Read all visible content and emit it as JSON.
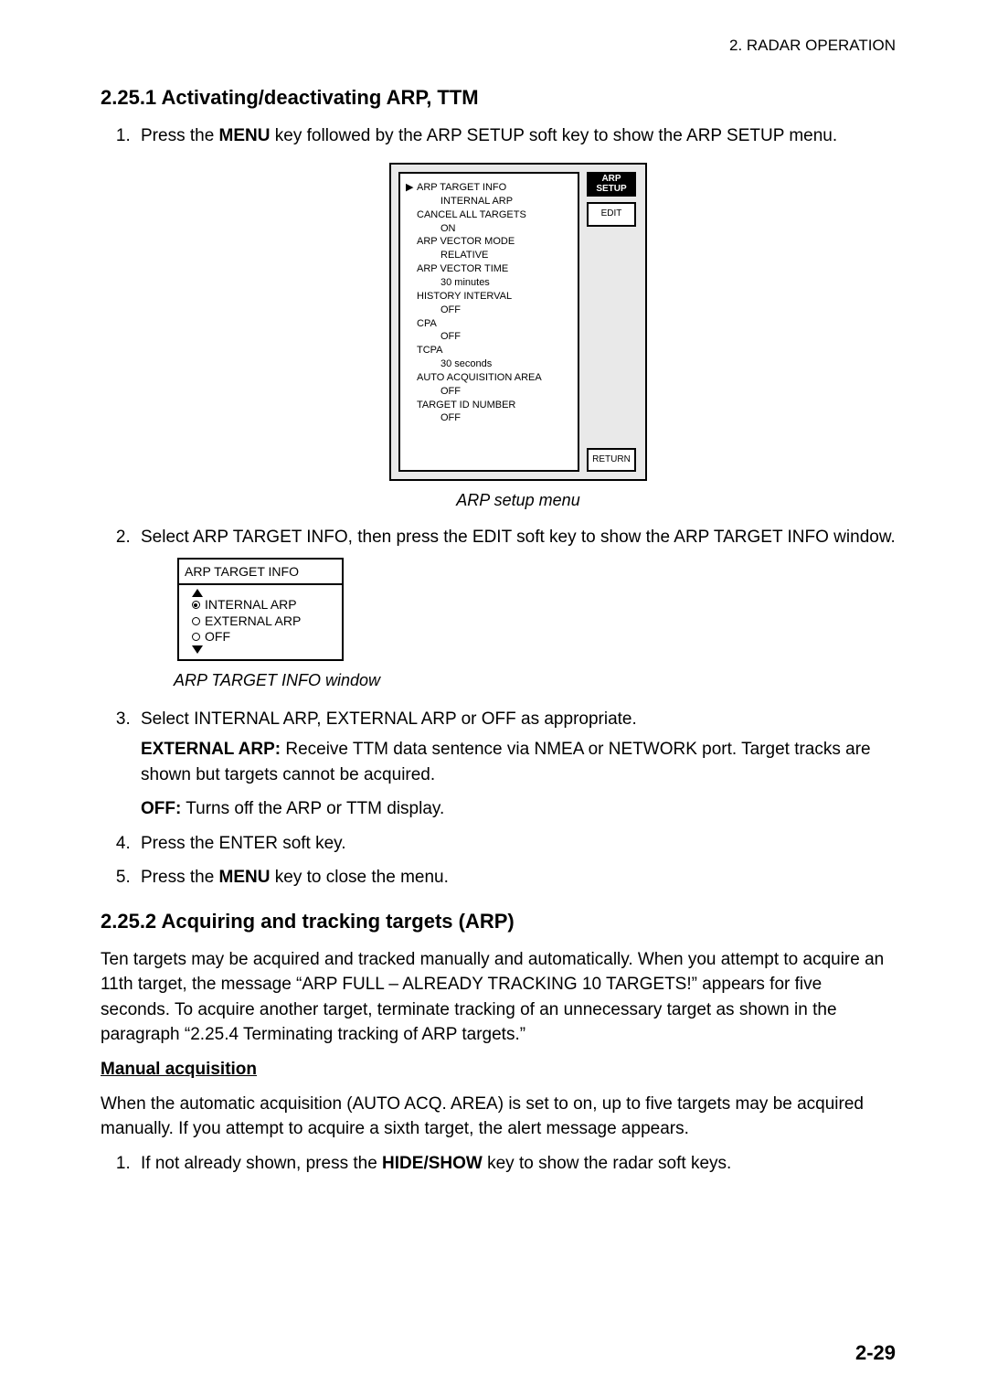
{
  "header": {
    "running": "2. RADAR OPERATION"
  },
  "sec1": {
    "title": "2.25.1  Activating/deactivating ARP, TTM",
    "step1_pre": "Press the ",
    "step1_b1": "MENU",
    "step1_post": " key followed by the ARP SETUP soft key to show the ARP SETUP menu.",
    "caption1": "ARP setup menu",
    "step2": "Select ARP TARGET INFO, then press the EDIT soft key to show the ARP TARGET INFO window.",
    "caption2": "ARP TARGET INFO window",
    "step3": "Select INTERNAL ARP, EXTERNAL ARP or OFF as appropriate.",
    "ext_label": "EXTERNAL ARP:",
    "ext_text": " Receive TTM data sentence via NMEA or NETWORK port. Target tracks are shown but targets cannot be acquired.",
    "off_label": "OFF:",
    "off_text": " Turns off the ARP or TTM display.",
    "step4": "Press the ENTER soft key.",
    "step5_pre": "Press the ",
    "step5_b": "MENU",
    "step5_post": " key to close the menu."
  },
  "fig_menu": {
    "title_side": "ARP\nSETUP",
    "edit": "EDIT",
    "return": "RETURN",
    "items": {
      "l1": "ARP TARGET INFO",
      "v1": "INTERNAL ARP",
      "l2": "CANCEL ALL TARGETS",
      "v2": "ON",
      "l3": "ARP VECTOR MODE",
      "v3": "RELATIVE",
      "l4": "ARP VECTOR TIME",
      "v4": "30 minutes",
      "l5": "HISTORY INTERVAL",
      "v5": "OFF",
      "l6": "CPA",
      "v6": "OFF",
      "l7": "TCPA",
      "v7": "30 seconds",
      "l8": "AUTO ACQUISITION AREA",
      "v8": "OFF",
      "l9": "TARGET ID NUMBER",
      "v9": "OFF"
    }
  },
  "fig_ati": {
    "title": "ARP TARGET INFO",
    "opt1": "INTERNAL ARP",
    "opt2": "EXTERNAL ARP",
    "opt3": "OFF"
  },
  "sec2": {
    "title": "2.25.2  Acquiring and tracking targets (ARP)",
    "para": "Ten targets may be acquired and tracked manually and automatically. When you attempt to acquire an 11th target, the message “ARP FULL – ALREADY TRACKING 10 TARGETS!” appears for five seconds. To acquire another target, terminate tracking of an unnecessary target as shown in the paragraph “2.25.4 Terminating tracking of ARP targets.”",
    "sub": "Manual acquisition",
    "sub_para": "When the automatic acquisition (AUTO ACQ. AREA) is set to on, up to five targets may be acquired manually. If you attempt to acquire a sixth target, the alert message appears.",
    "s1_pre": "If not already shown, press the ",
    "s1_b": "HIDE/SHOW",
    "s1_post": " key to show the radar soft keys."
  },
  "page_number": "2-29"
}
